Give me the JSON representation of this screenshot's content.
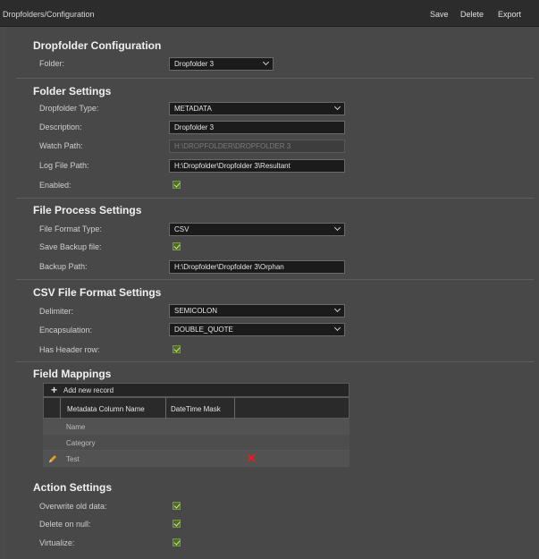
{
  "header": {
    "breadcrumb": "Dropfolders/Configuration",
    "save_label": "Save",
    "delete_label": "Delete",
    "export_label": "Export"
  },
  "dropfolder_config": {
    "title": "Dropfolder Configuration",
    "folder_label": "Folder:",
    "folder_value": "Dropfolder 3"
  },
  "folder_settings": {
    "title": "Folder Settings",
    "type_label": "Dropfolder Type:",
    "type_value": "METADATA",
    "description_label": "Description:",
    "description_value": "Dropfolder 3",
    "watch_label": "Watch Path:",
    "watch_value": "H:\\DROPFOLDER\\DROPFOLDER 3",
    "log_label": "Log File Path:",
    "log_value": "H:\\Dropfolder\\Dropfolder 3\\Resultant",
    "enabled_label": "Enabled:",
    "enabled_checked": true
  },
  "file_process": {
    "title": "File Process Settings",
    "format_label": "File Format Type:",
    "format_value": "CSV",
    "backup_label": "Save Backup file:",
    "backup_checked": true,
    "backup_path_label": "Backup Path:",
    "backup_path_value": "H:\\Dropfolder\\Dropfolder 3\\Orphan"
  },
  "csv_settings": {
    "title": "CSV File Format Settings",
    "delimiter_label": "Delimiter:",
    "delimiter_value": "SEMICOLON",
    "encapsulation_label": "Encapsulation:",
    "encapsulation_value": "DOUBLE_QUOTE",
    "header_label": "Has Header row:",
    "header_checked": true
  },
  "field_mappings": {
    "title": "Field Mappings",
    "add_label": "Add new record",
    "columns": [
      "Metadata Column Name",
      "DateTime Mask"
    ],
    "rows": [
      "Name",
      "Category",
      "Test"
    ]
  },
  "action_settings": {
    "title": "Action Settings",
    "overwrite_label": "Overwrite old data:",
    "overwrite_checked": true,
    "delete_null_label": "Delete on null:",
    "delete_null_checked": true,
    "virtualize_label": "Virtualize:",
    "virtualize_checked": true
  },
  "icons": {
    "add": "plus-icon",
    "edit": "pencil-icon",
    "delete": "x-icon",
    "dropdown": "chevron-down-icon",
    "checkbox": "checkmark-icon"
  },
  "colors": {
    "header_bg": "#2c2c2c",
    "panel_bg": "#484848",
    "input_bg": "#1b1b1b",
    "checkbox_green": "#4f6a2a",
    "edit_orange": "#e0a020",
    "delete_red": "#e02020"
  }
}
